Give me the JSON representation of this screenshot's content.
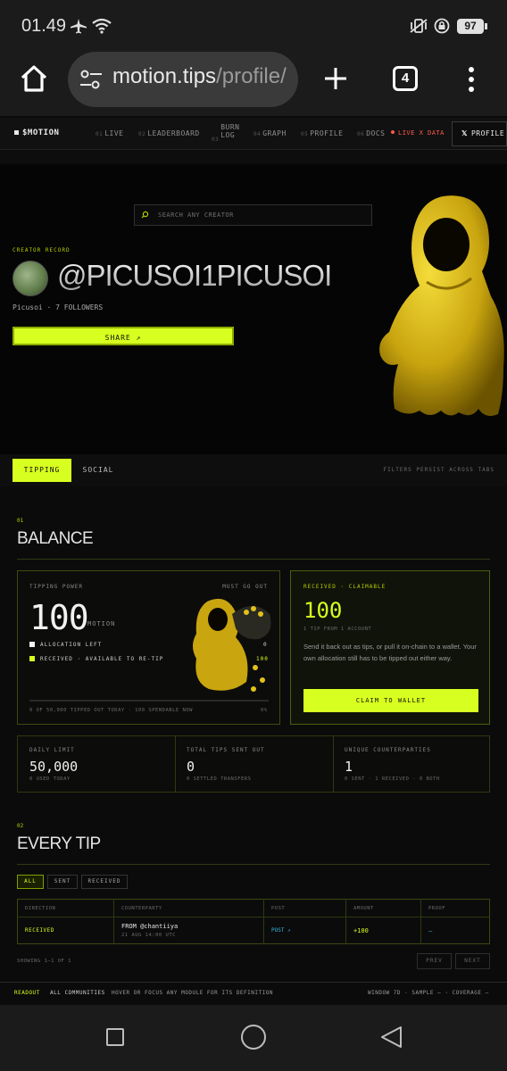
{
  "status_bar": {
    "time": "01.49",
    "battery": "97"
  },
  "browser": {
    "url_domain": "motion.tips",
    "url_path": "/profile/",
    "tab_count": "4"
  },
  "site_nav": {
    "brand": "$MOTION",
    "items": [
      {
        "num": "01",
        "label": "LIVE"
      },
      {
        "num": "02",
        "label": "LEADERBOARD"
      },
      {
        "num": "03",
        "label": "BURN"
      },
      {
        "num": "04",
        "label": "GRAPH"
      },
      {
        "num": "05",
        "label": "PROFILE"
      },
      {
        "num": "06",
        "label": "DOCS"
      }
    ],
    "burn_line2": "LOG",
    "live_badge": "LIVE X DATA",
    "profile_button": "PROFILE"
  },
  "hero": {
    "search_placeholder": "SEARCH ANY CREATOR",
    "kicker": "CREATOR RECORD",
    "handle": "@PICUSOI1PICUSOI",
    "subtitle": "Picusoi · 7 FOLLOWERS",
    "share_label": "SHARE ↗"
  },
  "tabs": {
    "items": [
      "TIPPING",
      "SOCIAL"
    ],
    "note": "FILTERS PERSIST ACROSS TABS"
  },
  "balance": {
    "section_no": "01",
    "title": "BALANCE",
    "tipping_power_label": "TIPPING POWER",
    "must_go_out": "MUST GO OUT",
    "amount": "100",
    "unit": "MOTION",
    "legend": [
      {
        "label": "ALLOCATION LEFT",
        "value": "0"
      },
      {
        "label": "RECEIVED · AVAILABLE TO RE-TIP",
        "value": "100"
      }
    ],
    "footer": "0 OF 50,000 TIPPED OUT TODAY · 100 SPENDABLE NOW",
    "progress": "0%",
    "claimable_label": "RECEIVED · CLAIMABLE",
    "claimable_amount": "100",
    "claimable_sub": "1 TIP FROM 1 ACCOUNT",
    "claimable_desc": "Send it back out as tips, or pull it on-chain to a wallet. Your own allocation still has to be tipped out either way.",
    "claim_button": "CLAIM TO WALLET"
  },
  "stats": [
    {
      "label": "DAILY LIMIT",
      "value": "50,000",
      "sub": "0 USED TODAY"
    },
    {
      "label": "TOTAL TIPS SENT OUT",
      "value": "0",
      "sub": "0 SETTLED TRANSFERS"
    },
    {
      "label": "UNIQUE COUNTERPARTIES",
      "value": "1",
      "sub": "0 SENT · 1 RECEIVED · 0 BOTH"
    }
  ],
  "every_tip": {
    "section_no": "02",
    "title": "EVERY TIP",
    "filters": [
      "ALL",
      "SENT",
      "RECEIVED"
    ],
    "columns": [
      "DIRECTION",
      "COUNTERPARTY",
      "POST",
      "AMOUNT",
      "PROOF"
    ],
    "rows": [
      {
        "direction": "RECEIVED",
        "counterparty": "FROM @chantiiya",
        "time": "21 AUG 14:00 UTC",
        "post": "POST ↗",
        "amount": "+100",
        "proof": "—"
      }
    ],
    "showing": "SHOWING 1–1 OF 1",
    "prev": "PREV",
    "next": "NEXT"
  },
  "readout": {
    "label": "READOUT",
    "communities": "ALL COMMUNITIES",
    "hint": "HOVER OR FOCUS ANY MODULE FOR ITS DEFINITION",
    "window": "WINDOW 7D · SAMPLE — · COVERAGE —"
  },
  "colors": {
    "accent": "#d7ff1f",
    "background": "#0b0b0b",
    "live": "#ff5a4a"
  }
}
